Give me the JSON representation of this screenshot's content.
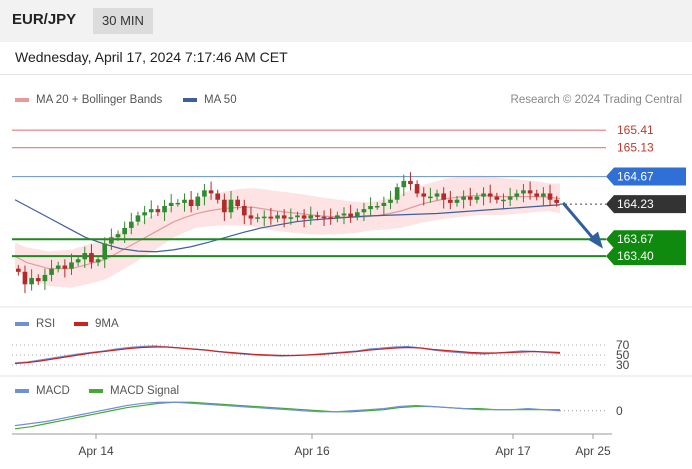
{
  "header": {
    "symbol": "EUR/JPY",
    "interval": "30 MIN",
    "datetime": "Wednesday, April 17, 2024 7:17:46 AM CET"
  },
  "legend": {
    "ma20_label": "MA 20 + Bollinger Bands",
    "ma50_label": "MA 50",
    "credit": "Research © 2024 Trading Central",
    "rsi_label": "RSI",
    "rsi_ma_label": "9MA",
    "macd_label": "MACD",
    "macd_signal_label": "MACD Signal"
  },
  "colors": {
    "ma20": "#e89a9a",
    "ma50": "#3d5f9e",
    "resistance": "#e57a7a",
    "pivot": "#7aa0d0",
    "support": "#1d8a1d",
    "current": "#333333",
    "rsi": "#6f8fd6",
    "rsi_ma": "#cc2222",
    "macd": "#6f8fd6",
    "macd_signal": "#44aa33",
    "candle_up": "#2e8b2e",
    "candle_down": "#b32a2a",
    "arrow": "#2f5f9f"
  },
  "chart_data": {
    "type": "line",
    "instrument": "EUR/JPY",
    "timeframe": "30 MIN",
    "x_ticks": [
      "Apr 14",
      "Apr 16",
      "Apr 17",
      "Apr 25"
    ],
    "levels": [
      {
        "value": 165.41,
        "label": "165.41",
        "kind": "resistance"
      },
      {
        "value": 165.13,
        "label": "165.13",
        "kind": "resistance"
      },
      {
        "value": 164.67,
        "label": "164.67",
        "kind": "pivot"
      },
      {
        "value": 164.23,
        "label": "164.23",
        "kind": "current"
      },
      {
        "value": 163.67,
        "label": "163.67",
        "kind": "support"
      },
      {
        "value": 163.4,
        "label": "163.40",
        "kind": "support"
      }
    ],
    "price_range": [
      162.7,
      165.7
    ],
    "close_series": [
      163.15,
      162.95,
      163.05,
      163.0,
      163.1,
      163.2,
      163.25,
      163.2,
      163.3,
      163.35,
      163.45,
      163.3,
      163.35,
      163.6,
      163.7,
      163.75,
      163.85,
      163.95,
      164.05,
      164.1,
      164.15,
      164.1,
      164.2,
      164.25,
      164.25,
      164.3,
      164.2,
      164.35,
      164.45,
      164.4,
      164.3,
      164.1,
      164.3,
      164.2,
      164.05,
      164.0,
      164.02,
      164.03,
      164.0,
      164.05,
      164.0,
      164.02,
      164.05,
      164.0,
      164.05,
      164.03,
      164.02,
      164.0,
      164.05,
      164.08,
      164.03,
      164.1,
      164.15,
      164.2,
      164.2,
      164.25,
      164.3,
      164.5,
      164.6,
      164.55,
      164.4,
      164.35,
      164.35,
      164.4,
      164.3,
      164.25,
      164.3,
      164.35,
      164.3,
      164.35,
      164.4,
      164.35,
      164.3,
      164.3,
      164.35,
      164.4,
      164.45,
      164.4,
      164.35,
      164.4,
      164.3,
      164.25
    ],
    "ma20_series": [
      163.4,
      163.3,
      163.25,
      163.2,
      163.2,
      163.2,
      163.25,
      163.3,
      163.35,
      163.45,
      163.55,
      163.65,
      163.75,
      163.85,
      163.95,
      164.02,
      164.08,
      164.12,
      164.15,
      164.17,
      164.18,
      164.18,
      164.15,
      164.12,
      164.1,
      164.08,
      164.06,
      164.04,
      164.03,
      164.02,
      164.02,
      164.03,
      164.05,
      164.08,
      164.12,
      164.18,
      164.24,
      164.28,
      164.32,
      164.34,
      164.36,
      164.37,
      164.36,
      164.35,
      164.35,
      164.35,
      164.35,
      164.34,
      164.32
    ],
    "ma50_series": [
      164.3,
      164.15,
      164.0,
      163.85,
      163.7,
      163.6,
      163.52,
      163.48,
      163.47,
      163.5,
      163.55,
      163.62,
      163.7,
      163.78,
      163.85,
      163.9,
      163.95,
      163.98,
      164.0,
      164.02,
      164.04,
      164.05,
      164.06,
      164.07,
      164.08,
      164.1,
      164.12,
      164.14,
      164.16,
      164.18,
      164.2,
      164.22
    ],
    "rsi": {
      "levels": [
        70,
        50,
        30
      ],
      "range": [
        20,
        80
      ],
      "series": [
        34,
        36,
        40,
        44,
        48,
        52,
        55,
        58,
        62,
        65,
        67,
        68,
        66,
        64,
        62,
        60,
        57,
        54,
        52,
        50,
        49,
        48,
        49,
        50,
        52,
        54,
        56,
        58,
        62,
        64,
        66,
        67,
        64,
        60,
        57,
        55,
        53,
        52,
        54,
        56,
        58,
        57,
        55,
        53
      ],
      "ma_series": [
        33,
        35,
        38,
        42,
        46,
        50,
        54,
        57,
        60,
        63,
        65,
        66,
        66,
        64,
        62,
        60,
        57,
        55,
        53,
        51,
        50,
        49,
        49,
        50,
        51,
        53,
        55,
        57,
        60,
        62,
        64,
        65,
        64,
        61,
        59,
        57,
        55,
        54,
        54,
        55,
        56,
        57,
        56,
        55
      ]
    },
    "macd": {
      "zero_label": "0",
      "range": [
        -0.2,
        0.12
      ],
      "series": [
        -0.14,
        -0.12,
        -0.1,
        -0.07,
        -0.04,
        -0.01,
        0.02,
        0.05,
        0.07,
        0.08,
        0.08,
        0.07,
        0.06,
        0.05,
        0.04,
        0.03,
        0.02,
        0.01,
        0.0,
        -0.01,
        -0.01,
        0.0,
        0.01,
        0.02,
        0.04,
        0.05,
        0.04,
        0.03,
        0.02,
        0.01,
        0.01,
        0.01,
        0.02,
        0.01,
        0.0
      ],
      "signal_series": [
        -0.17,
        -0.15,
        -0.12,
        -0.09,
        -0.06,
        -0.03,
        0.0,
        0.03,
        0.05,
        0.07,
        0.08,
        0.08,
        0.07,
        0.06,
        0.05,
        0.04,
        0.03,
        0.02,
        0.01,
        0.0,
        -0.01,
        -0.01,
        0.0,
        0.01,
        0.03,
        0.04,
        0.04,
        0.03,
        0.02,
        0.02,
        0.01,
        0.01,
        0.01,
        0.01,
        0.01
      ]
    }
  }
}
